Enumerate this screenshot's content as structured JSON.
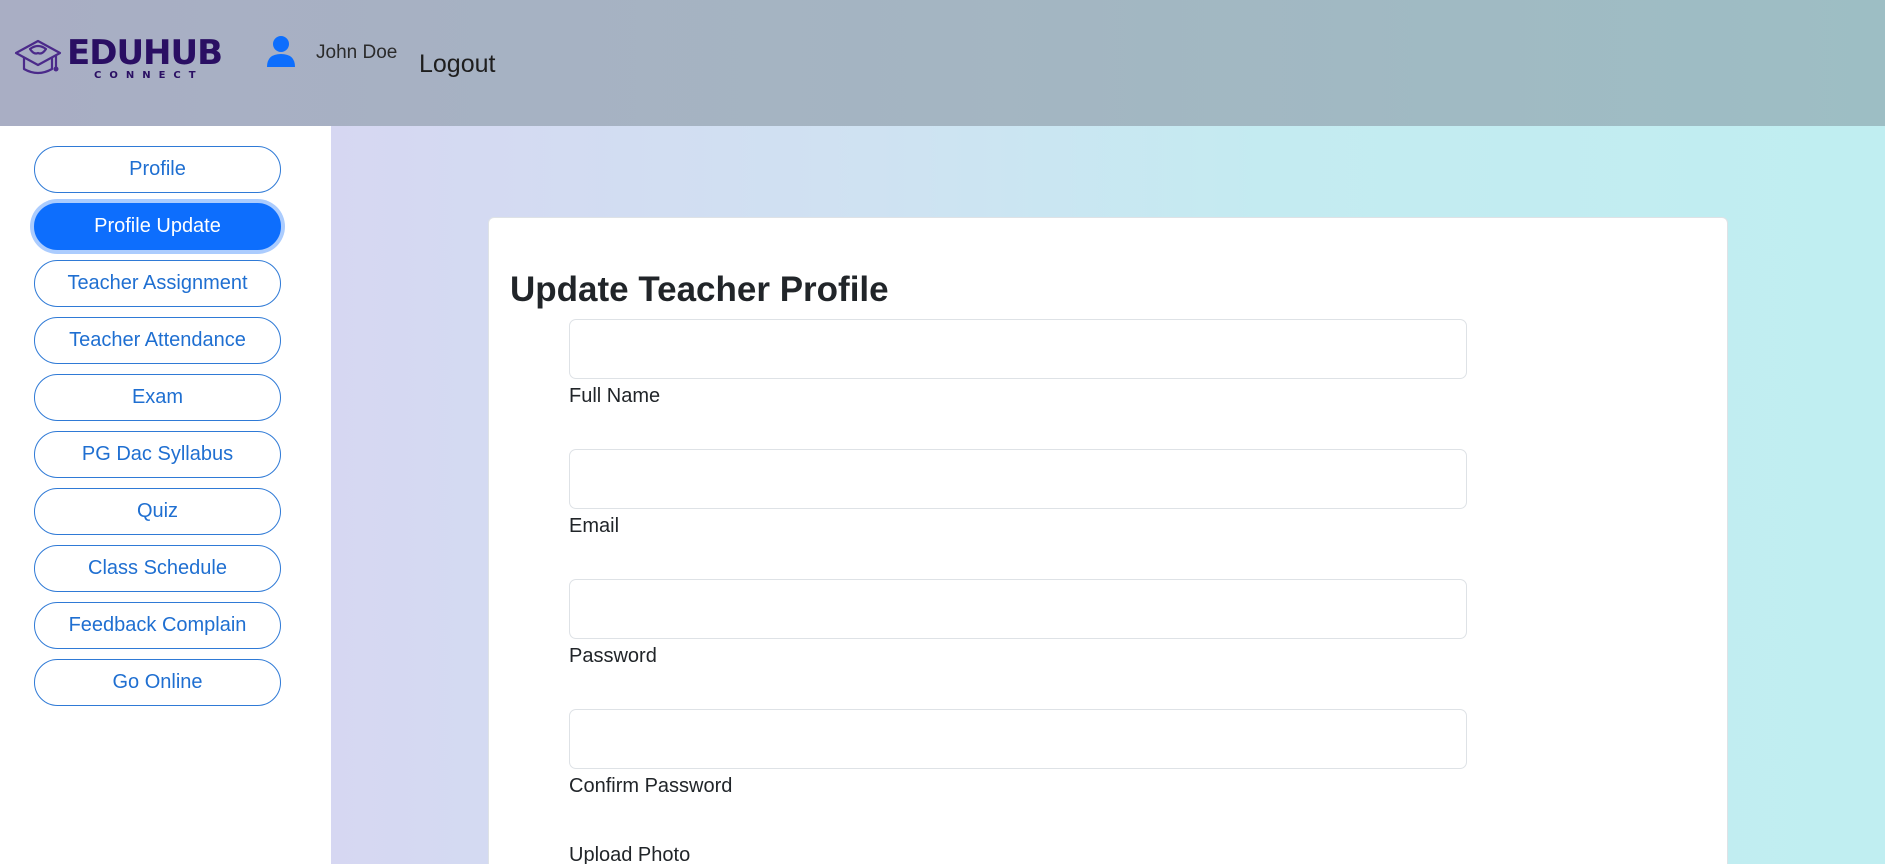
{
  "header": {
    "logo_text": "EDUHUB",
    "logo_subtext": "CONNECT",
    "user_icon": "user-icon",
    "user_name": "John Doe",
    "logout_label": "Logout"
  },
  "sidebar": {
    "items": [
      {
        "label": "Profile",
        "active": false
      },
      {
        "label": "Profile Update",
        "active": true
      },
      {
        "label": "Teacher Assignment",
        "active": false
      },
      {
        "label": "Teacher Attendance",
        "active": false
      },
      {
        "label": "Exam",
        "active": false
      },
      {
        "label": "PG Dac Syllabus",
        "active": false
      },
      {
        "label": "Quiz",
        "active": false
      },
      {
        "label": "Class Schedule",
        "active": false
      },
      {
        "label": "Feedback Complain",
        "active": false
      },
      {
        "label": "Go Online",
        "active": false
      }
    ]
  },
  "form": {
    "title": "Update Teacher Profile",
    "fields": [
      {
        "label": "Full Name",
        "value": ""
      },
      {
        "label": "Email",
        "value": ""
      },
      {
        "label": "Password",
        "value": ""
      },
      {
        "label": "Confirm Password",
        "value": ""
      }
    ],
    "upload_label": "Upload Photo"
  },
  "colors": {
    "accent": "#0d6efd",
    "brand": "#2a0f63",
    "nav_outline": "#2f7ad6"
  }
}
